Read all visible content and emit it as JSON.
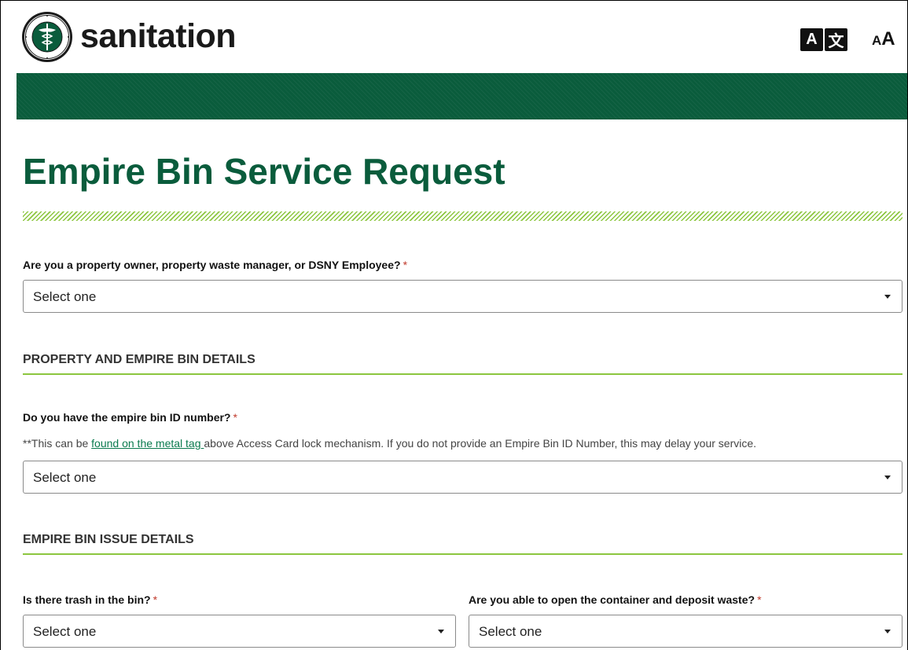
{
  "header": {
    "brand_name": "sanitation",
    "logo_icon": "nyc-dsny-seal-icon",
    "translate_glyph_left": "A",
    "translate_glyph_right": "文",
    "text_size_small": "A",
    "text_size_large": "A"
  },
  "colors": {
    "brand_green": "#0a5c3c",
    "accent_lime": "#8cc63f",
    "required_red": "#c0392b",
    "link_green": "#0a7a4e"
  },
  "page_title": "Empire Bin Service Request",
  "form": {
    "role_question": {
      "label": "Are you a property owner, property waste manager, or DSNY Employee?",
      "required_mark": "*",
      "selected": "Select one"
    },
    "section_property": "PROPERTY AND EMPIRE BIN DETAILS",
    "bin_id_question": {
      "label": "Do you have the empire bin ID number?",
      "required_mark": "*",
      "help_prefix": "**This can be ",
      "help_link": "found on the metal tag ",
      "help_suffix": "above Access Card lock mechanism. If you do not provide an Empire Bin ID Number, this may delay your service.",
      "selected": "Select one"
    },
    "section_issue": "EMPIRE BIN ISSUE DETAILS",
    "trash_question": {
      "label": "Is there trash in the bin?",
      "required_mark": "*",
      "selected": "Select one"
    },
    "open_question": {
      "label": "Are you able to open the container and deposit waste?",
      "required_mark": "*",
      "selected": "Select one"
    }
  }
}
